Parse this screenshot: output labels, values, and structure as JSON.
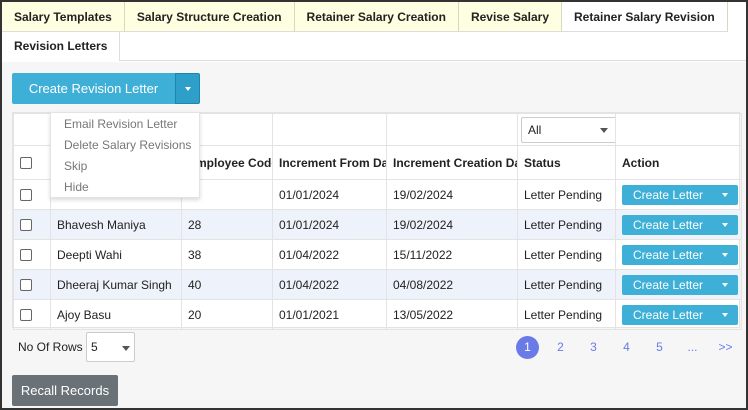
{
  "tabs_row1": [
    {
      "label": "Salary Templates"
    },
    {
      "label": "Salary Structure Creation"
    },
    {
      "label": "Retainer Salary Creation"
    },
    {
      "label": "Revise Salary"
    },
    {
      "label": "Retainer Salary Revision"
    }
  ],
  "tabs_row2": [
    {
      "label": "Revision Letters"
    }
  ],
  "create_button": {
    "label": "Create Revision Letter"
  },
  "dropdown_items": [
    {
      "label": "Email Revision Letter"
    },
    {
      "label": "Delete Salary Revisions"
    },
    {
      "label": "Skip"
    },
    {
      "label": "Hide"
    }
  ],
  "table": {
    "status_filter": "All",
    "headers": [
      "",
      "",
      "Employee Code",
      "Increment From Date",
      "Increment Creation Date",
      "Status",
      "Action"
    ],
    "rows": [
      {
        "name": "",
        "code": "",
        "from": "01/01/2024",
        "created": "19/02/2024",
        "status": "Letter Pending",
        "action": "Create Letter"
      },
      {
        "name": "Bhavesh Maniya",
        "code": "28",
        "from": "01/01/2024",
        "created": "19/02/2024",
        "status": "Letter Pending",
        "action": "Create Letter"
      },
      {
        "name": "Deepti Wahi",
        "code": "38",
        "from": "01/04/2022",
        "created": "15/11/2022",
        "status": "Letter Pending",
        "action": "Create Letter"
      },
      {
        "name": "Dheeraj Kumar Singh",
        "code": "40",
        "from": "01/04/2022",
        "created": "04/08/2022",
        "status": "Letter Pending",
        "action": "Create Letter"
      },
      {
        "name": "Ajoy Basu",
        "code": "20",
        "from": "01/01/2021",
        "created": "13/05/2022",
        "status": "Letter Pending",
        "action": "Create Letter"
      }
    ]
  },
  "footer": {
    "rows_label": "No Of Rows :",
    "rows_value": "5",
    "pages": [
      "1",
      "2",
      "3",
      "4",
      "5",
      "...",
      ">>"
    ],
    "active_page": "1"
  },
  "recall_button": {
    "label": "Recall Records"
  },
  "colors": {
    "primary": "#3eb0d8",
    "tab_bg": "#fefee0",
    "row_alt": "#eef2fa",
    "pager": "#6a7be8",
    "recall": "#6b7277"
  }
}
